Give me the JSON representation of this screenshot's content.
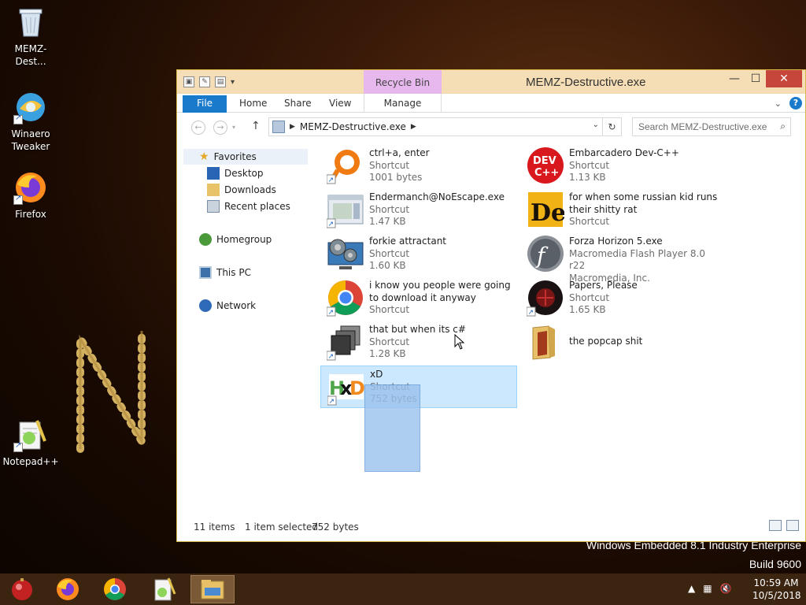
{
  "desktop": {
    "icons": [
      {
        "label": "MEMZ-Dest..."
      },
      {
        "label": "Winaero Tweaker"
      },
      {
        "label": "Firefox"
      },
      {
        "label": "Notepad++"
      }
    ],
    "watermark_line1": "Windows Embedded 8.1 Industry Enterprise",
    "watermark_line2": "Build 9600"
  },
  "window": {
    "title": "MEMZ-Destructive.exe",
    "context_tab": "Recycle Bin Tools",
    "close_glyph": "✕",
    "min_glyph": "—",
    "max_glyph": "☐",
    "ribbon_tabs": {
      "file": "File",
      "home": "Home",
      "share": "Share",
      "view": "View",
      "manage": "Manage"
    },
    "help_glyph": "?",
    "address": {
      "path": "MEMZ-Destructive.exe",
      "sep": "▶"
    },
    "search": {
      "placeholder": "Search MEMZ-Destructive.exe"
    },
    "nav_pane": {
      "favorites": "Favorites",
      "desktop": "Desktop",
      "downloads": "Downloads",
      "recent": "Recent places",
      "homegroup": "Homegroup",
      "thispc": "This PC",
      "network": "Network"
    },
    "files": [
      {
        "name": "ctrl+a, enter",
        "type": "Shortcut",
        "size": "1001 bytes",
        "icon": "orange-ring-icon"
      },
      {
        "name": "Embarcadero Dev-C++",
        "type": "Shortcut",
        "size": "1.13 KB",
        "icon": "devcpp-icon"
      },
      {
        "name": "Endermanch@NoEscape.exe",
        "type": "Shortcut",
        "size": "1.47 KB",
        "icon": "window-app-icon"
      },
      {
        "name": "for when some russian kid runs their shitty rat",
        "type": "Shortcut",
        "size": "",
        "icon": "de-icon"
      },
      {
        "name": "forkie attractant",
        "type": "Shortcut",
        "size": "1.60 KB",
        "icon": "gear-monitor-icon"
      },
      {
        "name": "Forza Horizon 5.exe",
        "type": "Macromedia Flash Player 8.0  r22",
        "size": "Macromedia, Inc.",
        "icon": "flash-icon"
      },
      {
        "name": "i know you people were going to download it anyway",
        "type": "Shortcut",
        "size": "",
        "icon": "chrome-icon"
      },
      {
        "name": "Papers, Please",
        "type": "Shortcut",
        "size": "1.65 KB",
        "icon": "papers-please-icon"
      },
      {
        "name": "that but when its c#",
        "type": "Shortcut",
        "size": "1.28 KB",
        "icon": "stacked-windows-icon"
      },
      {
        "name": "the popcap shit",
        "type": "",
        "size": "",
        "icon": "folder-icon"
      },
      {
        "name": "xD",
        "type": "Shortcut",
        "size": "752 bytes",
        "icon": "hxd-icon"
      }
    ],
    "status": {
      "count": "11 items",
      "selected": "1 item selected",
      "size": "752 bytes"
    }
  },
  "taskbar": {
    "time": "10:59 AM",
    "date": "10/5/2018",
    "apps": [
      "start-orb-icon",
      "firefox-icon",
      "chrome-icon",
      "notepadpp-icon",
      "file-explorer-icon"
    ]
  },
  "colors": {
    "accent": "#1979ca",
    "context_tab": "#e7b8ee",
    "titlebar": "#f5ddb5",
    "close": "#c7463c",
    "selection": "#cce8ff"
  }
}
